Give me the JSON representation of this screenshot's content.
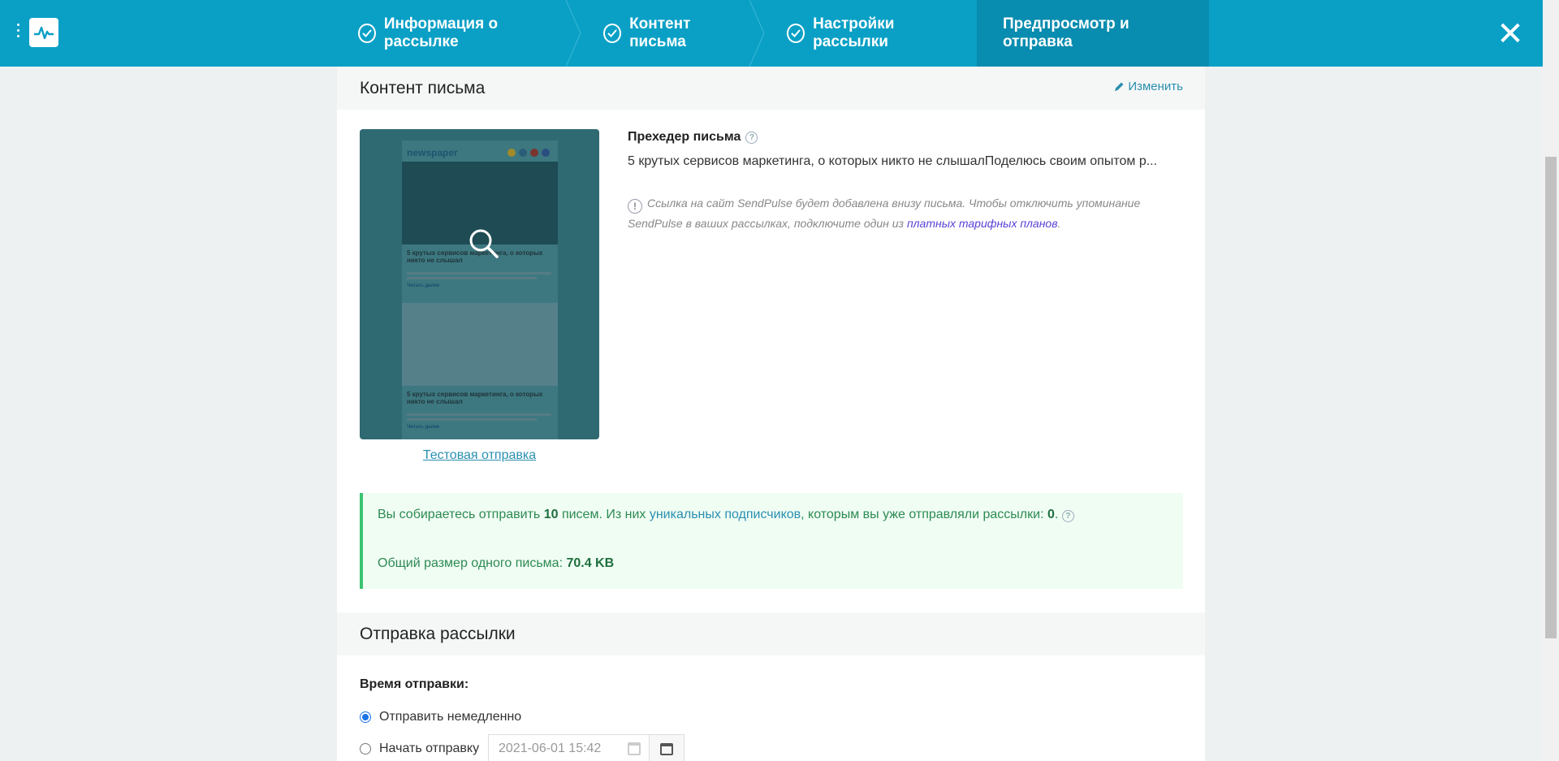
{
  "header": {
    "steps": [
      {
        "label": "Информация о рассылке",
        "done": true
      },
      {
        "label": "Контент письма",
        "done": true
      },
      {
        "label": "Настройки рассылки",
        "done": true
      },
      {
        "label": "Предпросмотр и отправка",
        "active": true
      }
    ],
    "close_label": "✕",
    "accent": "#0aa0c6"
  },
  "content_section": {
    "title": "Контент письма",
    "edit_label": "Изменить",
    "preview": {
      "brand": "newspaper",
      "article1_title": "5 крутых сервисов маркетинга, о которых никто не слышал",
      "article1_link": "Читать далее",
      "article2_title": "5 крутых сервисов маркетинга, о которых никто не слышал",
      "article2_link": "Читать далее"
    },
    "test_send_label": "Тестовая отправка",
    "preheader_title": "Прехедер письма",
    "preheader_text": "5 крутых сервисов маркетинга, о которых никто не слышалПоделюсь своим опытом р...",
    "notice_text": "Ссылка на сайт SendPulse будет добавлена внизу письма. Чтобы отключить упоминание SendPulse в ваших рассылках, подключите один из",
    "notice_link": "платных тарифных планов",
    "notice_end": "."
  },
  "summary": {
    "line1_pre": "Вы собираетесь отправить",
    "count": "10",
    "line1_mid": "писем.  Из них",
    "unique_link": "уникальных подписчиков",
    "line1_post": ", которым вы уже отправляли рассылки:",
    "sent_before": "0",
    "dot": ".",
    "size_label": "Общий размер одного письма:",
    "size_value": "70.4 KB"
  },
  "send_section": {
    "title": "Отправка рассылки",
    "time_label": "Время отправки:",
    "option_now": "Отправить немедленно",
    "option_later": "Начать отправку",
    "datetime_value": "2021-06-01 15:42"
  }
}
